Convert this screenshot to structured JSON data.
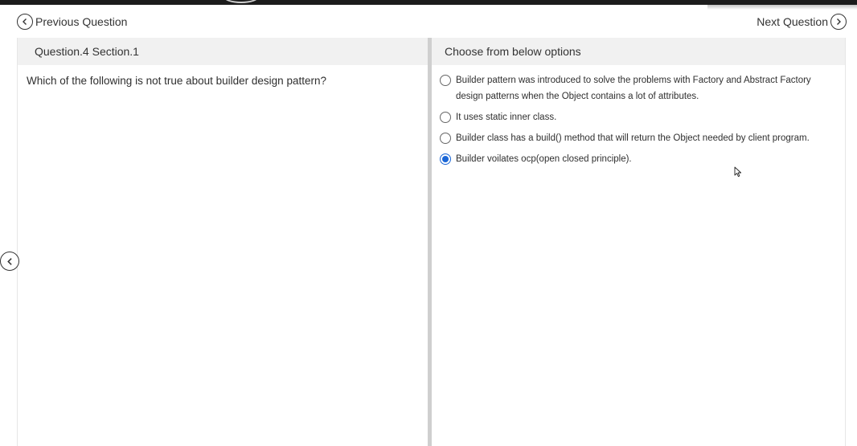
{
  "nav": {
    "prev_label": "Previous Question",
    "next_label": "Next Question"
  },
  "left_panel": {
    "header": "Question.4 Section.1",
    "question": "Which of the following is not true about builder design pattern?"
  },
  "right_panel": {
    "header": "Choose from below options",
    "options": [
      {
        "label": "Builder pattern was introduced to solve the problems with Factory and Abstract Factory design patterns when the Object contains a lot of attributes.",
        "selected": false
      },
      {
        "label": "It uses static inner class.",
        "selected": false
      },
      {
        "label": "Builder class has a build() method that will return the Object needed by client program.",
        "selected": false
      },
      {
        "label": "Builder voilates ocp(open closed principle).",
        "selected": true
      }
    ]
  },
  "icons": {
    "prev": "chevron-left-circle-icon",
    "next": "chevron-right-circle-icon",
    "side": "chevron-left-circle-icon",
    "cursor": "mouse-pointer-icon"
  },
  "colors": {
    "accent": "#1a66d6",
    "header_bg": "#f1f1f1"
  }
}
